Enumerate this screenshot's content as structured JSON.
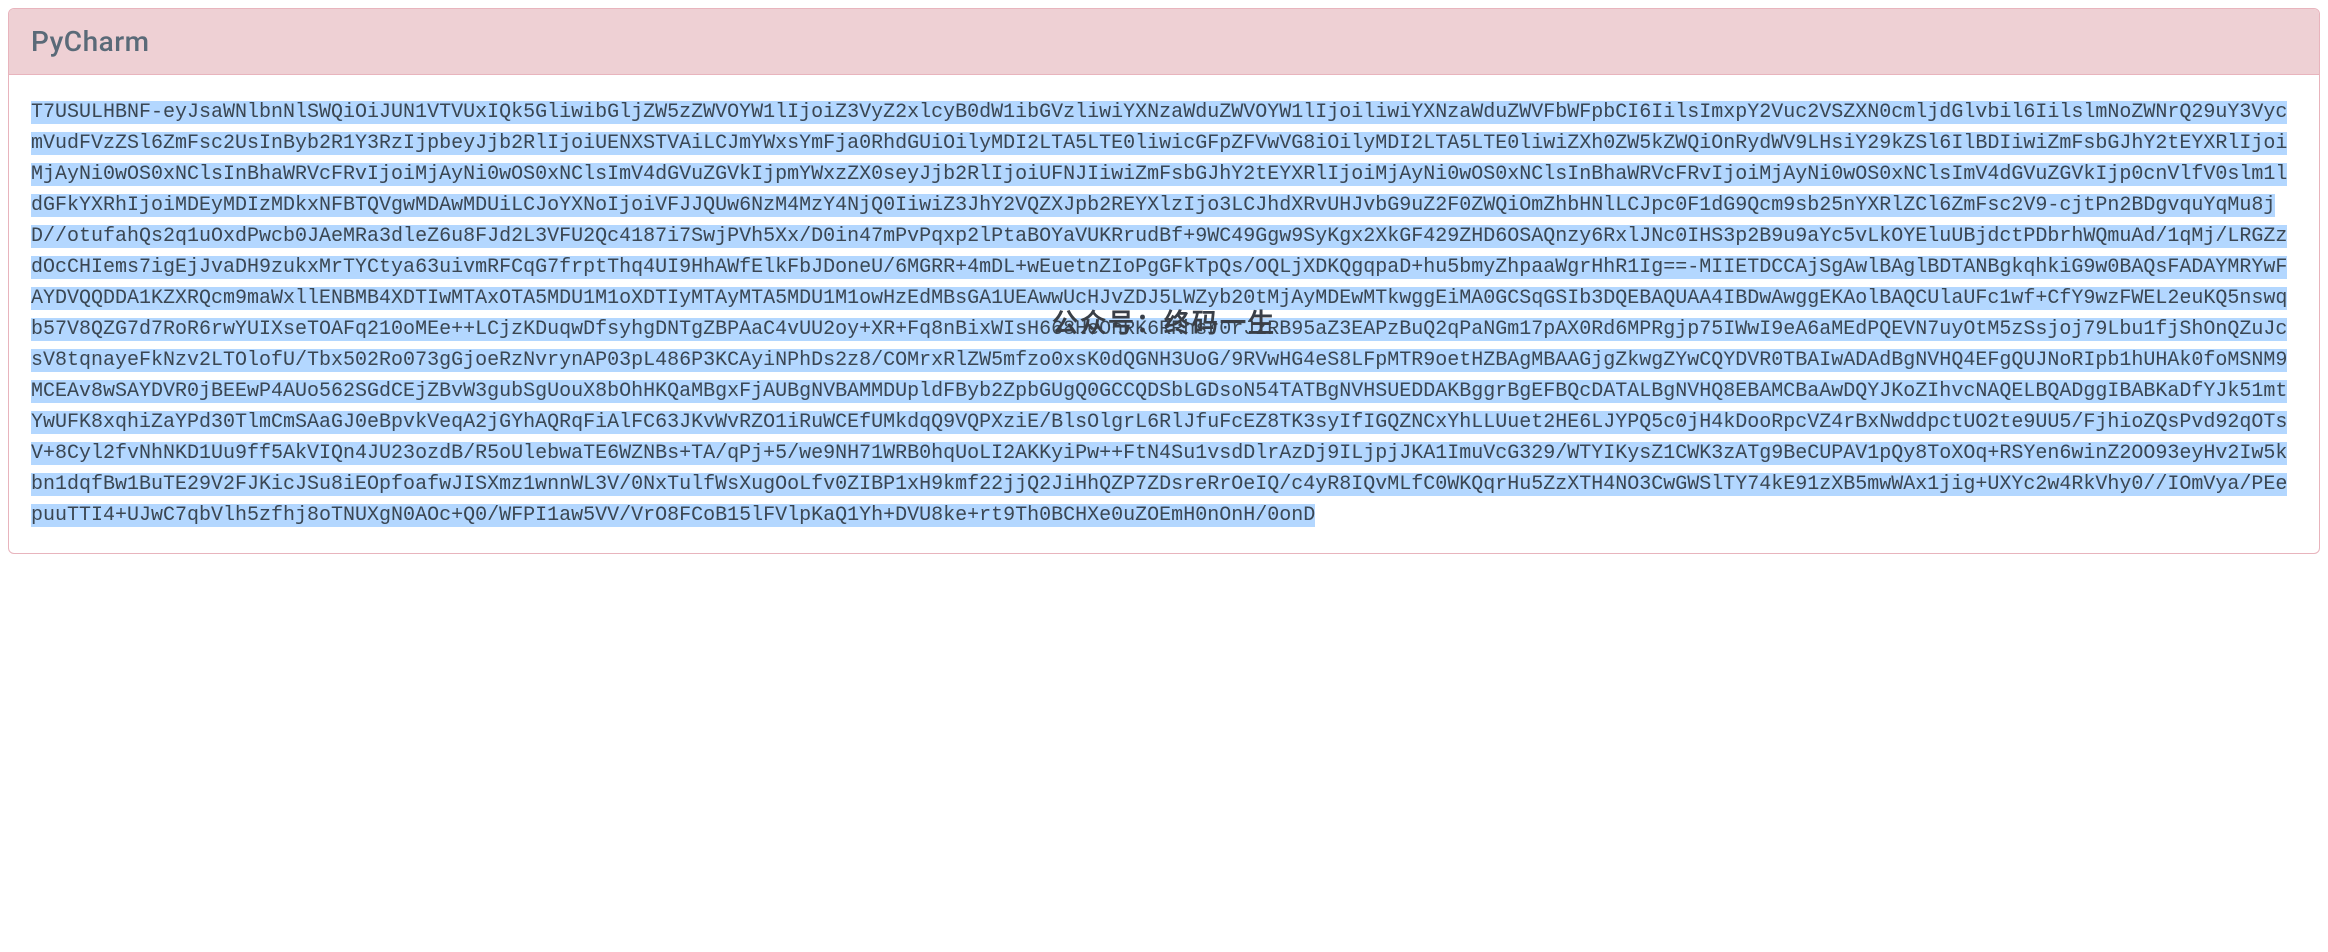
{
  "card": {
    "title": "PyCharm"
  },
  "content": {
    "text_highlighted": "T7USULHBNF-eyJsaWNlbnNlSWQiOiJUN1VTVUxIQk5GliwibGljZW5zZWVOYW1lIjoiZ3VyZ2xlcyB0dW1ibGVzliwiYXNzaWduZWVOYW1lIjoiliwiYXNzaWduZWVFbWFpbCI6IilsImxpY2Vuc2VSZXN0cmljdGlvbil6IilslmNoZWNrQ29uY3VycmVudFVzZSl6ZmFsc2UsInByb2R1Y3RzIjpbeyJjb2RlIjoiUENXSTVAiLCJmYWxsYmFja0RhdGUiOilyMDI2LTA5LTE0liwicGFpZFVwVG8iOilyMDI2LTA5LTE0liwiZXh0ZW5kZWQiOnRydWV9LHsiY29kZSl6IlBDIiwiZmFsbGJhY2tEYXRlIjoiMjAyNi0wOS0xNClsInBhaWRVcFRvIjoiMjAyNi0wOS0xNClsImV4dGVuZGVkIjpmYWxzZX0seyJjb2RlIjoiUFNJIiwiZmFsbGJhY2tEYXRlIjoiMjAyNi0wOS0xNClsInBhaWRVcFRvIjoiMjAyNi0wOS0xNClsImV4dGVuZGVkIjp0cnVlfV0slm1ldGFkYXRhIjoiMDEyMDIzMDkxNFBTQVgwMDAwMDUiLCJoYXNoIjoiVFJJQUw6NzM4MzY4NjQ0IiwiZ3JhY2VQZXJpb2REYXlzIjo3LCJhdXRvUHJvbG9uZ2F0ZWQiOmZhbHNlLCJpc0F1dG9Qcm9sb25nYXRlZCl6ZmFsc2V9-cjtPn2BDgvquYqMu8jD//otufahQs2q1uOxdPwcb0JAeMRa3dleZ6u8FJd2L3VFU2Qc4187i7SwjPVh5Xx/D0in47mPvPqxp2lPtaBOYaVUKRrudBf+9WC49Ggw9SyKgx2XkGF429ZHD6OSAQnzy6RxlJNc0IHS3p2B9u9aYc5vLkOYEluUBjdctPDbrhWQmuAd/1qMj/LRGZzdOcCHIems7igEjJvaDH9zukxMrTYCtya63uivmRFCqG7frptThq4UI9HhAWfElkFbJDoneU/6MGRR+4mDL+wEuetnZIoPgGFkTpQs/OQLjXDKQgqpaD+hu5bmyZhpaaWgrHhR1Ig==-MIIETDCCAjSgAwlBAglBDTANBgkqhkiG9w0BAQsFADAYMRYwFAYDVQQDDA1KZXRQcm9maWxllENBMB4XDTIwMTAxOTA5MDU1M1oXDTIyMTAyMTA5MDU1M1owHzEdMBsGA1UEAwwUcHJvZDJ5LWZyb20tMjAyMDEwMTkwggEiMA0GCSqGSIb3DQEBAQUAA4IBDwAwggEKAolBAQCUlaUFc1wf+CfY9wzFWEL2euKQ5nswqb57V8QZG7d7RoR6rwYUIXseTOAFq210oMEe++LCjzKDuqwDfsyhgDNTgZBPAaC4vUU2oy+XR+Fq8nBixWIsH668HeOnRK6RRhsr0rJzRB95aZ3EAPzBuQ2qPaNGm17pAX0Rd6MPRgjp75IWwI9eA6aMEdPQEVN7uyOtM5zSsjoj79Lbu1fjShOnQZuJcsV8tqnayeFkNzv2LTOlofU/Tbx502Ro073gGjoeRzNvrynAP03pL486P3KCAyiNPhDs2z8/COMrxRlZW5mfzo0xsK0dQGNH3UoG/9RVwHG4eS8LFpMTR9oetHZBAgMBAAGjgZkwgZYwCQYDVR0TBAIwADAdBgNVHQ4EFgQUJNoRIpb1hUHAk0foMSNM9MCEAv8wSAYDVR0jBEEwP4AUo562SGdCEjZBvW3gubSgUouX8bOhHKQaMBgxFjAUBgNVBAMMDUpldFByb2ZpbGUgQ0GCCQDSbLGDsoN54TATBgNVHSUEDDAKBggrBgEFBQcDATALBgNVHQ8EBAMCBaAwDQYJKoZIhvcNAQELBQADggIBABKaDfYJk51mtYwUFK8xqhiZaYPd30TlmCmSAaGJ0eBpvkVeqA2jGYhAQRqFiAlFC63JKvWvRZO1iRuWCEfUMkdqQ9VQPXziE/BlsOlgrL6RlJfuFcEZ8TK3syIfIGQZNCxYhLLUuet2HE6LJYPQ5c0jH4kDooRpcVZ4rBxNwddpctUO2te9UU5/FjhioZQsPvd92qOTsV+8Cyl2fvNhNKD1Uu9ff5AkVIQn4JU23ozdB/R5oUlebwaTE6WZNBs+TA/qPj+5/we9NH71WRB0hqUoLI2AKKyiPw++FtN4Su1vsdDlrAzDj9ILjpjJKA1ImuVcG329/WTYIKysZ1CWK3zATg9BeCUPAV1pQy8ToXOq+RSYen6winZ2OO93eyHv2Iw5kbn1dqfBw1BuTE29V2FJKicJSu8iEOpfoafwJISXmz1wnnWL3V/0NxTulfWsXugOoLfv0ZIBP1xH9kmf22jjQ2JiHhQZP7ZDsreRrOeIQ/c4yR8IQvMLfC0WKQqrHu5ZzXTH4NO3CwGWSlTY74kE91zXB5mwWAx1jig+UXYc2w4RkVhy0//IOmVya/PEepuuTTI4+UJwC7qbVlh5zfhj8oTNUXgN0AOc+Q0/WFPI1aw5VV/VrO8FCoB15lFVlpKaQ1Yh+DVU8ke+rt9Th0BCHXe0uZOEmH0nOnH/0onD"
  },
  "watermark": {
    "text": "公众号：终码一生"
  }
}
